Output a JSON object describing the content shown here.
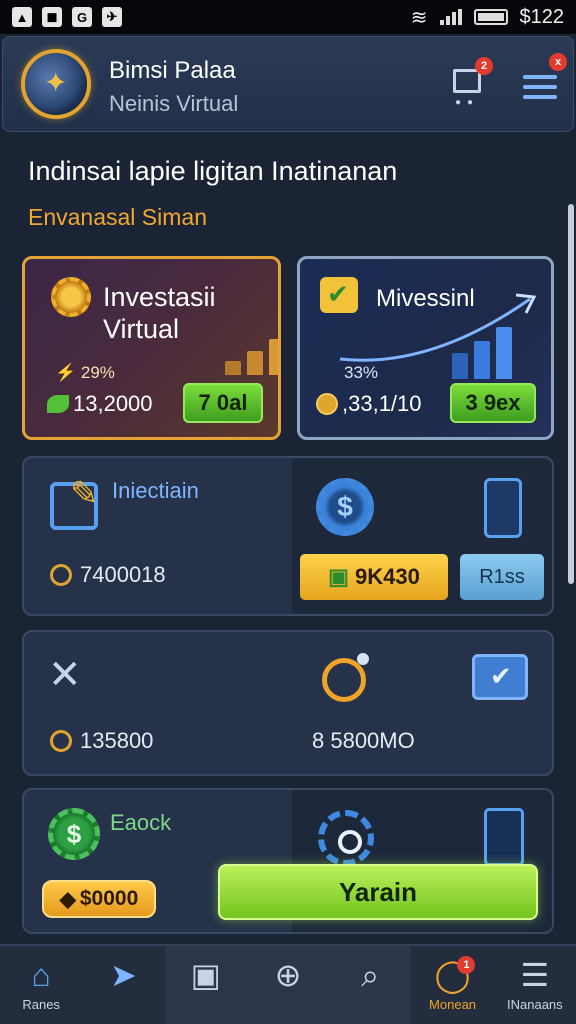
{
  "status_bar": {
    "left_icons": [
      "image-icon",
      "photo-icon",
      "g-icon",
      "game-icon"
    ],
    "left_glyphs": [
      "▲",
      "◼",
      "G",
      "✈"
    ],
    "wifi_glyph": "≋",
    "time": "$122"
  },
  "header": {
    "app_title": "Bimsi Palaa",
    "app_subtitle": "Neinis Virtual",
    "cart_badge": "2",
    "menu_badge": "x"
  },
  "headline": "Indinsai lapie ligitan Inatinanan",
  "subheadline": "Envanasal Siman",
  "cards": [
    {
      "title": "Investasii Virtual",
      "percent": "29%",
      "amount": "13,2000",
      "button": "7 0al",
      "accent": "#e5a335"
    },
    {
      "title": "Mivessinl",
      "percent": "33%",
      "amount": ",33,1/10",
      "button": "3 9ex",
      "accent": "#8ea5c4"
    }
  ],
  "panels": [
    {
      "label": "Iniectiain",
      "value": "7400018",
      "button_primary": "9K430",
      "button_secondary": "R1ss"
    },
    {
      "value_left": "135800",
      "value_right": "8 5800MO"
    },
    {
      "label": "Eaock",
      "button_amount": "$0000",
      "cta": "Yarain"
    }
  ],
  "bottom_nav": [
    {
      "icon": "home-icon",
      "glyph": "⌂",
      "label": "Ranes",
      "color": "#5aa0f0"
    },
    {
      "icon": "send-icon",
      "glyph": "➤",
      "label": "",
      "color": "#7fb4ff"
    },
    {
      "icon": "wallet-icon",
      "glyph": "▣",
      "label": "",
      "color": "#c8d3e6"
    },
    {
      "icon": "plus-icon",
      "glyph": "⊕",
      "label": "",
      "color": "#c8d3e6"
    },
    {
      "icon": "search-icon",
      "glyph": "⌕",
      "label": "",
      "color": "#c8d3e6"
    },
    {
      "icon": "target-icon",
      "glyph": "◯",
      "label": "Monean",
      "color": "#f0a32a",
      "badge": "1"
    },
    {
      "icon": "menu-icon",
      "glyph": "☰",
      "label": "INanaans",
      "color": "#c8d3e6"
    }
  ],
  "colors": {
    "background": "#1b2435",
    "accent_gold": "#e5a335",
    "accent_blue": "#5aa0f0",
    "accent_green": "#7bdc3a"
  }
}
